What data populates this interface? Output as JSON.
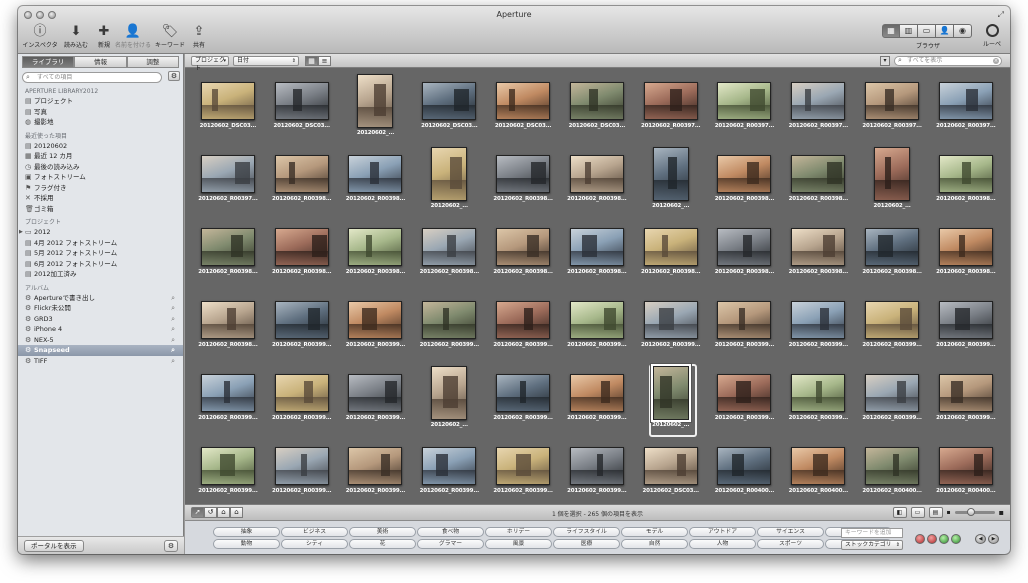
{
  "window": {
    "title": "Aperture"
  },
  "toolbar": {
    "inspector": "インスペクタ",
    "import": "読み込む",
    "new": "新規",
    "name": "名前を付ける",
    "keyword": "キーワード",
    "share": "共有",
    "browser": "ブラウザ",
    "loupe": "ルーペ"
  },
  "sidebar": {
    "tabs": [
      "ライブラリ",
      "情報",
      "調整"
    ],
    "search_placeholder": "すべての項目",
    "library_header": "APERTURE LIBRARY2012",
    "library_items": [
      "プロジェクト",
      "写真",
      "撮影地"
    ],
    "recent_header": "最近使った項目",
    "recent_items": [
      "20120602",
      "最近 12 カ月",
      "最後の読み込み",
      "フォトストリーム",
      "フラグ付き",
      "不採用",
      "ゴミ箱"
    ],
    "projects_header": "プロジェクト",
    "project_items": [
      "2012",
      "4月 2012 フォトストリーム",
      "5月 2012 フォトストリーム",
      "6月 2012 フォトストリーム",
      "2012加工済み"
    ],
    "albums_header": "アルバム",
    "album_items": [
      "Apertureで書き出し",
      "Flickr未公開",
      "GRD3",
      "iPhone 4",
      "NEX-5",
      "Snapseed",
      "TIFF"
    ],
    "show_portal": "ポータルを表示"
  },
  "browser_bar": {
    "project_popup": "プロジェクト",
    "sort_popup": "日付",
    "search_placeholder": "すべてを表示"
  },
  "photos": [
    "20120602_DSC03...",
    "20120602_DSC03...",
    "20120602_...",
    "20120602_DSC03...",
    "20120602_DSC03...",
    "20120602_DSC03...",
    "20120602_R00397...",
    "20120602_R00397...",
    "20120602_R00397...",
    "20120602_R00397...",
    "20120602_R00397...",
    "20120602_R00397...",
    "20120602_R00398...",
    "20120602_R00398...",
    "20120602_...",
    "20120602_R00398...",
    "20120602_R00398...",
    "20120602_...",
    "20120602_R00398...",
    "20120602_R00398...",
    "20120602_...",
    "20120602_R00398...",
    "20120602_R00398...",
    "20120602_R00398...",
    "20120602_R00398...",
    "20120602_R00398...",
    "20120602_R00398...",
    "20120602_R00398...",
    "20120602_R00398...",
    "20120602_R00398...",
    "20120602_R00398...",
    "20120602_R00398...",
    "20120602_R00398...",
    "20120602_R00398...",
    "20120602_R00399...",
    "20120602_R00399...",
    "20120602_R00399...",
    "20120602_R00399...",
    "20120602_R00399...",
    "20120602_R00399...",
    "20120602_R00399...",
    "20120602_R00399...",
    "20120602_R00399...",
    "20120602_R00399...",
    "20120602_R00399...",
    "20120602_R00399...",
    "20120602_R00399...",
    "20120602_...",
    "20120602_R00399...",
    "20120602_R00399...",
    "20120602_...",
    "20120602_R00399...",
    "20120602_R00399...",
    "20120602_R00399...",
    "20120602_R00399...",
    "20120602_R00399...",
    "20120602_R00399...",
    "20120602_R00399...",
    "20120602_R00399...",
    "20120602_R00399...",
    "20120602_R00399...",
    "20120602_DSC03...",
    "20120602_R00400...",
    "20120602_R00400...",
    "20120602_R00400...",
    "20120602_R00400..."
  ],
  "status": {
    "text": "1 個を選択 - 265 個の項目を表示"
  },
  "keywords": {
    "row1": [
      "抽象",
      "ビジネス",
      "美術",
      "食べ物",
      "ホリデー",
      "ライフスタイル",
      "モデル",
      "アウトドア",
      "サイエンス",
      "静物"
    ],
    "row2": [
      "動物",
      "シティ",
      "花",
      "グラマー",
      "風景",
      "医療",
      "自然",
      "人物",
      "スポーツ",
      "テクノロジー"
    ],
    "add_placeholder": "キーワードを追加",
    "category_select": "ストックカテゴリ"
  },
  "colors": {
    "accent": "#8b97a9",
    "browser_bg": "#666666"
  }
}
